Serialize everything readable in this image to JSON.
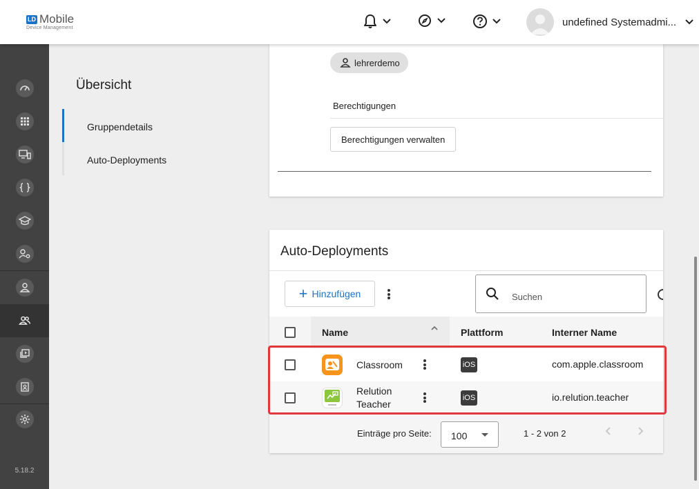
{
  "header": {
    "logo_badge": "LD",
    "logo_title": "Mobile",
    "logo_subtitle": "Device Management",
    "user_name": "undefined Systemadmi..."
  },
  "sidebar": {
    "version": "5.18.2"
  },
  "nav": {
    "title": "Übersicht",
    "items": [
      "Gruppendetails",
      "Auto-Deployments"
    ]
  },
  "details_card": {
    "chip_user": "lehrerdemo",
    "permissions_label": "Berechtigungen",
    "manage_permissions_button": "Berechtigungen verwalten"
  },
  "auto_deployments": {
    "title": "Auto-Deployments",
    "add_button": "Hinzufügen",
    "search_placeholder": "Suchen",
    "columns": [
      "Name",
      "Plattform",
      "Interner Name"
    ],
    "rows": [
      {
        "name": "Classroom",
        "platform": "iOS",
        "internal_name": "com.apple.classroom",
        "icon": "classroom-app-icon"
      },
      {
        "name_line1": "Relution",
        "name_line2": "Teacher",
        "platform": "iOS",
        "internal_name": "io.relution.teacher",
        "icon": "relution-teacher-app-icon"
      }
    ],
    "footer": {
      "per_page_label": "Einträge pro Seite:",
      "per_page_value": "100",
      "range": "1 - 2 von 2"
    }
  },
  "colors": {
    "accent": "#1a73c6",
    "sidebar_bg": "#424242",
    "highlight": "#e0373d",
    "classroom_orange": "#f7941d",
    "relution_green": "#8cc63f"
  }
}
